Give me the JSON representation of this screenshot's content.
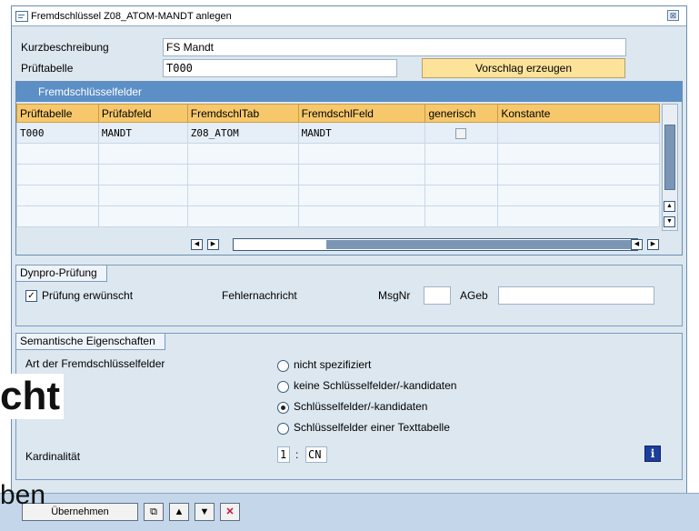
{
  "dialog": {
    "title": "Fremdschlüssel Z08_ATOM-MANDT anlegen",
    "close_glyph": "⊠"
  },
  "form": {
    "short_desc_label": "Kurzbeschreibung",
    "short_desc_value": "FS Mandt",
    "check_table_label": "Prüftabelle",
    "check_table_value": "T000",
    "proposal_button": "Vorschlag erzeugen"
  },
  "fk_fields": {
    "title": "Fremdschlüsselfelder",
    "columns": [
      "Prüftabelle",
      "Prüfabfeld",
      "FremdschlTab",
      "FremdschlFeld",
      "generisch",
      "Konstante"
    ],
    "rows": [
      {
        "check_table": "T000",
        "check_field": "MANDT",
        "foreign_table": "Z08_ATOM",
        "foreign_field": "MANDT",
        "generic": false,
        "constant": ""
      }
    ]
  },
  "dynpro": {
    "title": "Dynpro-Prüfung",
    "check_wanted_label": "Prüfung erwünscht",
    "check_wanted": true,
    "error_msg_label": "Fehlernachricht",
    "msgnr_label": "MsgNr",
    "msgnr_value": "",
    "area_label": "AGeb",
    "area_value": ""
  },
  "semantic": {
    "title": "Semantische Eigenschaften",
    "field_type_label": "Art der Fremdschlüsselfelder",
    "options": [
      {
        "label": "nicht spezifiziert",
        "selected": false
      },
      {
        "label": "keine Schlüsselfelder/-kandidaten",
        "selected": false
      },
      {
        "label": "Schlüsselfelder/-kandidaten",
        "selected": true
      },
      {
        "label": "Schlüsselfelder einer Texttabelle",
        "selected": false
      }
    ],
    "cardinality_label": "Kardinalität",
    "cardinality_left": "1",
    "cardinality_sep": ":",
    "cardinality_right": "CN",
    "info_glyph": "i"
  },
  "footer": {
    "accept_label": "Übernehmen"
  },
  "overlay": {
    "big_text": "cht",
    "small_text": "ben"
  }
}
